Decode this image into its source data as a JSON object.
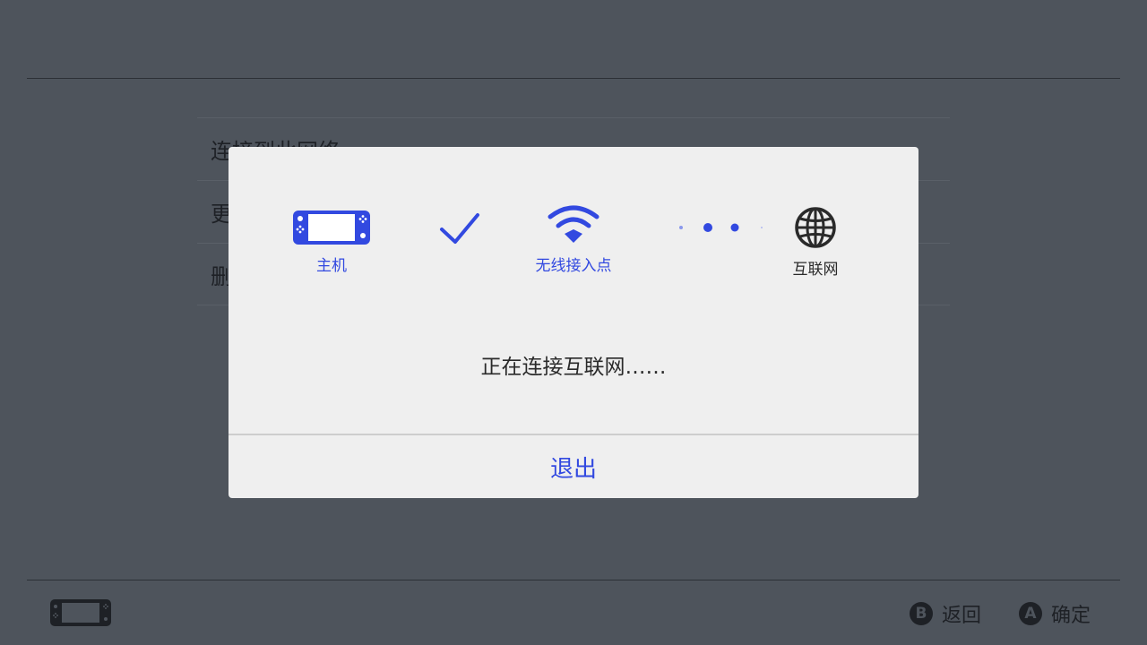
{
  "background_menu": {
    "items": [
      {
        "label": "连接到此网络"
      },
      {
        "label": "更"
      },
      {
        "label": "删"
      }
    ]
  },
  "footer": {
    "back": {
      "button": "B",
      "label": "返回"
    },
    "confirm": {
      "button": "A",
      "label": "确定"
    }
  },
  "dialog": {
    "nodes": {
      "console": {
        "label": "主机"
      },
      "access_point": {
        "label": "无线接入点"
      },
      "internet": {
        "label": "互联网"
      }
    },
    "status": "正在连接互联网……",
    "quit_label": "退出"
  },
  "colors": {
    "accent": "#3249e0",
    "dialog_bg": "#efefef",
    "screen_bg": "#4e545c"
  },
  "icons": {
    "console": "switch-console-icon",
    "check": "checkmark-icon",
    "wifi": "wifi-icon",
    "progress": "progress-dots-icon",
    "internet": "globe-icon",
    "footer_console": "switch-console-icon"
  }
}
